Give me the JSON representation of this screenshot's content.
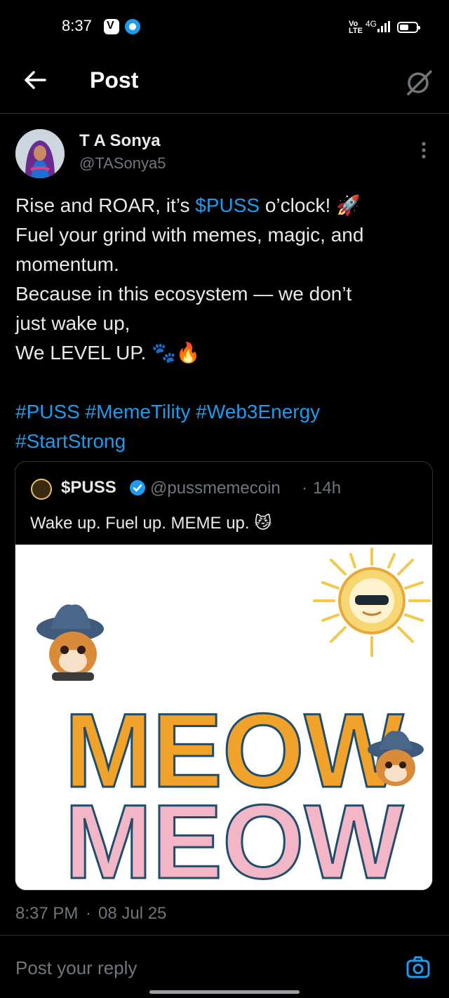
{
  "status_bar": {
    "time": "8:37",
    "volte": "Vo LTE",
    "network": "4G"
  },
  "header": {
    "title": "Post"
  },
  "post": {
    "author_name": "T A Sonya",
    "author_handle": "@TASonya5",
    "body": {
      "line1_prefix": "Rise and ROAR, it’s ",
      "line1_link": "$PUSS",
      "line1_suffix": " o’clock! 🚀",
      "line2": "Fuel your grind with memes, magic, and",
      "line3": "momentum.",
      "line4": "Because in this ecosystem — we don’t",
      "line5": "just wake up,",
      "line6": "We LEVEL UP. 🐾🔥",
      "hashtags_line1": "#PUSS #MemeTility #Web3Energy",
      "hashtags_line2": "#StartStrong"
    },
    "time": "8:37 PM",
    "separator": "·",
    "date": "08 Jul 25"
  },
  "quote": {
    "name": "$PUSS",
    "handle": "@pussmemecoin",
    "separator": "·",
    "time": "14h",
    "text": "Wake up. Fuel up. MEME up. 😼",
    "image_line1": "MEOW",
    "image_line2": "MEOW"
  },
  "reply": {
    "placeholder": "Post your reply"
  },
  "colors": {
    "accent": "#1d9bf0",
    "background": "#000000",
    "muted": "#71767b"
  }
}
